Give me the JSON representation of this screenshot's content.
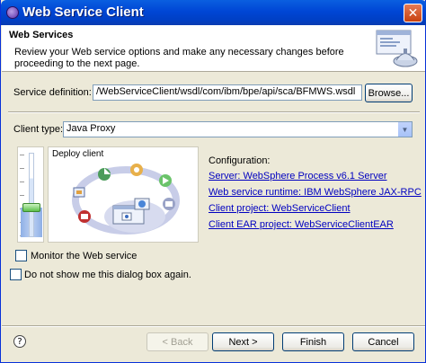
{
  "window": {
    "title": "Web Service Client"
  },
  "banner": {
    "title": "Web Services",
    "description": "Review your Web service options and make any necessary changes before proceeding to the next page."
  },
  "service": {
    "label": "Service definition:",
    "value": "/WebServiceClient/wsdl/com/ibm/bpe/api/sca/BFMWS.wsdl",
    "browse_label": "Browse..."
  },
  "client_type": {
    "label": "Client type:",
    "selected": "Java Proxy"
  },
  "slider": {
    "level": 0.35
  },
  "diagram": {
    "label": "Deploy client"
  },
  "configuration": {
    "title": "Configuration:",
    "links": [
      "Server: WebSphere Process v6.1 Server",
      "Web service runtime: IBM WebSphere JAX-RPC",
      "Client project: WebServiceClient",
      "Client EAR project: WebServiceClientEAR"
    ]
  },
  "options": {
    "monitor_label": "Monitor the Web service",
    "monitor_checked": false,
    "dont_show_label": "Do not show me this dialog box again.",
    "dont_show_checked": false
  },
  "footer": {
    "help_glyph": "?",
    "back_label": "< Back",
    "next_label": "Next >",
    "finish_label": "Finish",
    "cancel_label": "Cancel"
  },
  "colors": {
    "titlebar": "#0046d5",
    "link": "#0000c0",
    "dialog_bg": "#ece9d8"
  }
}
